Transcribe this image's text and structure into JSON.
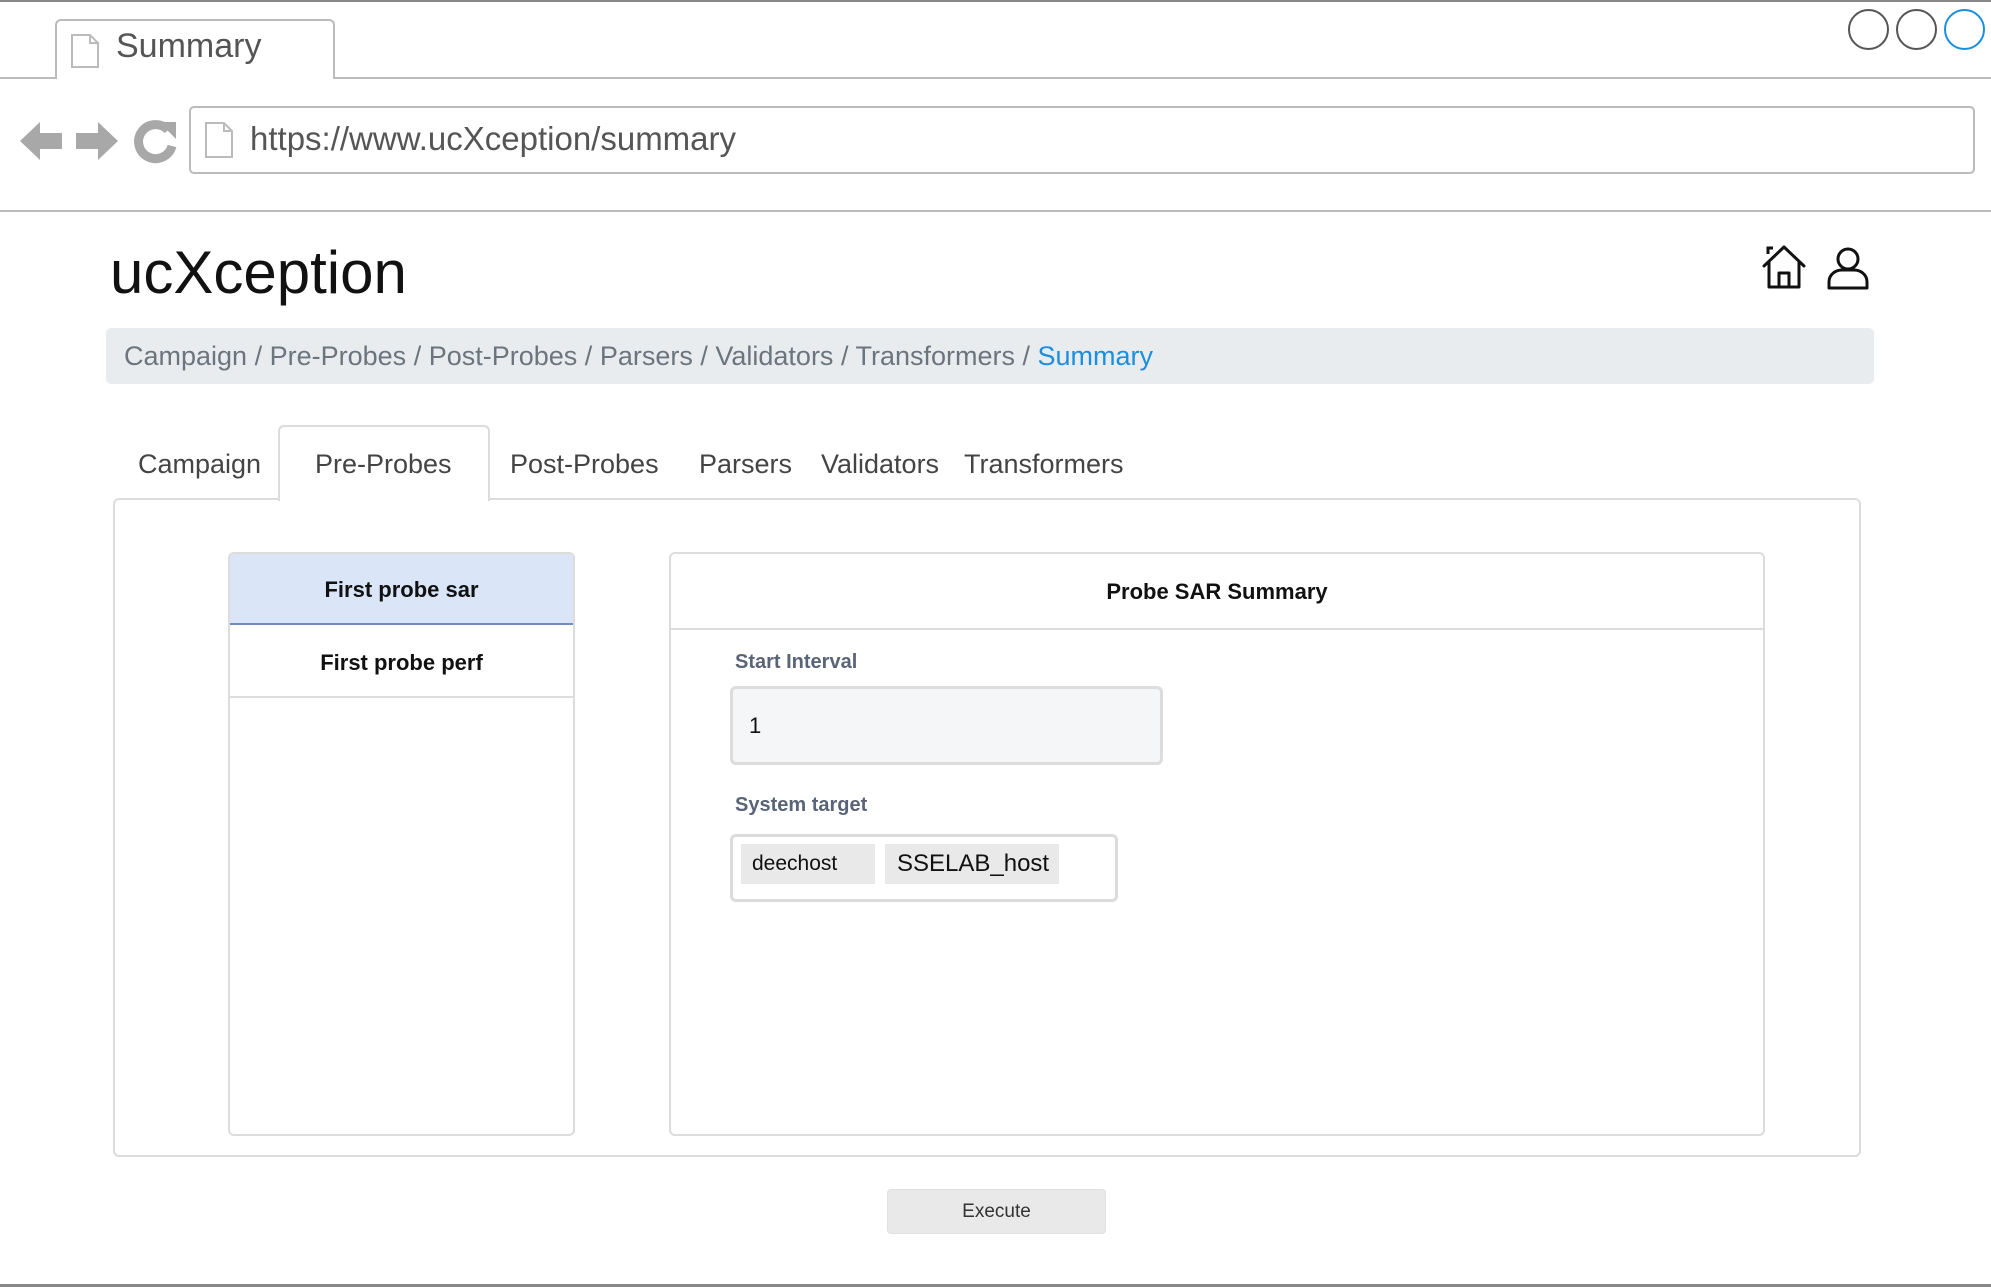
{
  "browser": {
    "tab_title": "Summary",
    "url": "https://www.ucXception/summary"
  },
  "app": {
    "title": "ucXception"
  },
  "breadcrumb": {
    "items": [
      "Campaign",
      "Pre-Probes",
      "Post-Probes",
      "Parsers",
      "Validators",
      "Transformers"
    ],
    "active": "Summary",
    "separator": "/"
  },
  "tabs": {
    "items": [
      "Campaign",
      "Pre-Probes",
      "Post-Probes",
      "Parsers",
      "Validators",
      "Transformers"
    ],
    "selected": "Pre-Probes"
  },
  "probes": {
    "items": [
      "First probe sar",
      "First probe perf"
    ],
    "selected": "First probe sar"
  },
  "summary": {
    "title": "Probe SAR Summary",
    "start_interval_label": "Start Interval",
    "start_interval_value": "1",
    "system_target_label": "System target",
    "system_targets": [
      "deechost",
      "SSELAB_host"
    ]
  },
  "actions": {
    "execute_label": "Execute"
  },
  "colors": {
    "accent": "#1a8fe0",
    "breadcrumb_bg": "#e9ecef",
    "selected_item_bg": "#dae6f8",
    "field_label": "#5a6478"
  },
  "icons": [
    "document-icon",
    "back-arrow-icon",
    "forward-arrow-icon",
    "reload-icon",
    "home-icon",
    "user-icon"
  ]
}
